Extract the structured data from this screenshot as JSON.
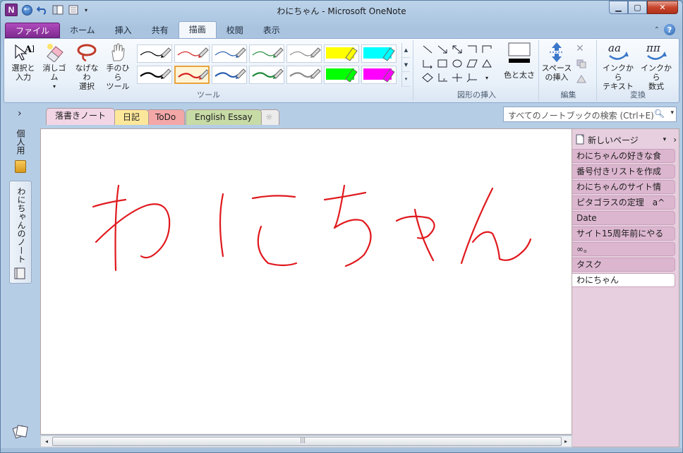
{
  "window": {
    "title": "わにちゃん - Microsoft OneNote"
  },
  "app_icon_letter": "N",
  "ribbon_tabs": [
    {
      "label": "ファイル"
    },
    {
      "label": "ホーム"
    },
    {
      "label": "挿入"
    },
    {
      "label": "共有"
    },
    {
      "label": "描画"
    },
    {
      "label": "校閲"
    },
    {
      "label": "表示"
    }
  ],
  "ribbon": {
    "tools": {
      "select_label": "選択と\n入力",
      "eraser_label": "消しゴム",
      "lasso_label": "なげなわ\n選択",
      "pan_label": "手のひら\nツール",
      "group_label": "ツール"
    },
    "pens": [
      {
        "color": "#000000",
        "kind": "pen"
      },
      {
        "color": "#d62020",
        "kind": "pen"
      },
      {
        "color": "#2a5db0",
        "kind": "pen"
      },
      {
        "color": "#1f8a3a",
        "kind": "pen"
      },
      {
        "color": "#8a8a8a",
        "kind": "pen"
      },
      {
        "color": "#ffff00",
        "kind": "highlighter"
      },
      {
        "color": "#00ffff",
        "kind": "highlighter"
      },
      {
        "color": "#000000",
        "kind": "thick-pen"
      },
      {
        "color": "#d62020",
        "kind": "thick-pen"
      },
      {
        "color": "#2a5db0",
        "kind": "thick-pen"
      },
      {
        "color": "#1f8a3a",
        "kind": "thick-pen"
      },
      {
        "color": "#8a8a8a",
        "kind": "thick-pen"
      },
      {
        "color": "#00ff00",
        "kind": "highlighter"
      },
      {
        "color": "#ff00ff",
        "kind": "highlighter"
      }
    ],
    "selected_pen": 8,
    "shapes": {
      "group_label": "図形の挿入",
      "color_width_label": "色と太さ"
    },
    "edit": {
      "insert_space_label": "スペース\nの挿入",
      "group_label": "編集"
    },
    "convert": {
      "ink_to_text_label": "インクから\nテキスト",
      "ink_to_math_label": "インクから\n数式",
      "group_label": "変換"
    }
  },
  "section_tabs": [
    {
      "label": "落書きノート",
      "color": "#f2d6e6",
      "active": true
    },
    {
      "label": "日記",
      "color": "#fde79a"
    },
    {
      "label": "ToDo",
      "color": "#f4a7a7"
    },
    {
      "label": "English Essay",
      "color": "#c7dba6"
    },
    {
      "label": "☼",
      "color": "#e6e6e6"
    }
  ],
  "search": {
    "placeholder": "すべてのノートブックの検索 (Ctrl+E)"
  },
  "notebooks": {
    "personal_label": "個人用",
    "wani_label": "わにちゃんのノート",
    "expand_glyph": "›"
  },
  "pages": {
    "new_page_label": "新しいページ",
    "items": [
      {
        "label": "わにちゃんの好きな食"
      },
      {
        "label": "番号付きリストを作成"
      },
      {
        "label": "わにちゃんのサイト情"
      },
      {
        "label": "ピタゴラスの定理　a^"
      },
      {
        "label": "Date"
      },
      {
        "label": "サイト15周年前にやる"
      },
      {
        "label": "∞。"
      },
      {
        "label": "タスク"
      },
      {
        "label": "わにちゃん",
        "active": true
      }
    ]
  },
  "ink": {
    "text": "わにちゃん",
    "color": "#e0191e"
  },
  "scrollbar": {
    "grip": "|||"
  }
}
